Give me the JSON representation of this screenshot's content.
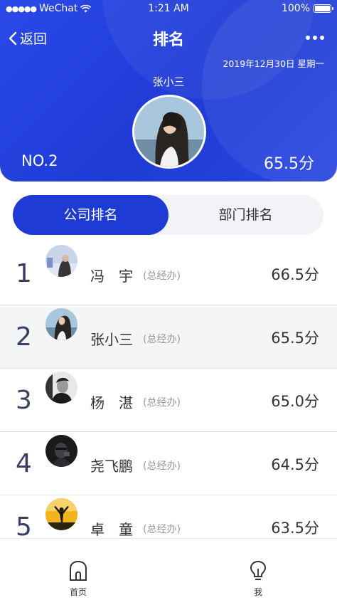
{
  "status": {
    "carrier": "WeChat",
    "time": "1:21 AM",
    "battery": "100%"
  },
  "nav": {
    "back_label": "返回",
    "title": "排名"
  },
  "header": {
    "date": "2019年12月30日 星期一",
    "user_name": "张小三",
    "rank": "NO.2",
    "score": "65.5分"
  },
  "tabs": {
    "company": "公司排名",
    "department": "部门排名"
  },
  "ranking": [
    {
      "rank": "1",
      "name": "冯　宇",
      "dept": "(总经办)",
      "score": "66.5分"
    },
    {
      "rank": "2",
      "name": "张小三",
      "dept": "(总经办)",
      "score": "65.5分"
    },
    {
      "rank": "3",
      "name": "杨　湛",
      "dept": "(总经办)",
      "score": "65.0分"
    },
    {
      "rank": "4",
      "name": "尧飞鹏",
      "dept": "(总经办)",
      "score": "64.5分"
    },
    {
      "rank": "5",
      "name": "卓　童",
      "dept": "(总经办)",
      "score": "63.5分"
    }
  ],
  "tabbar": {
    "home": "首页",
    "me": "我"
  },
  "colors": {
    "primary": "#1f3bd6",
    "highlight_row": "#f4f5f7"
  }
}
